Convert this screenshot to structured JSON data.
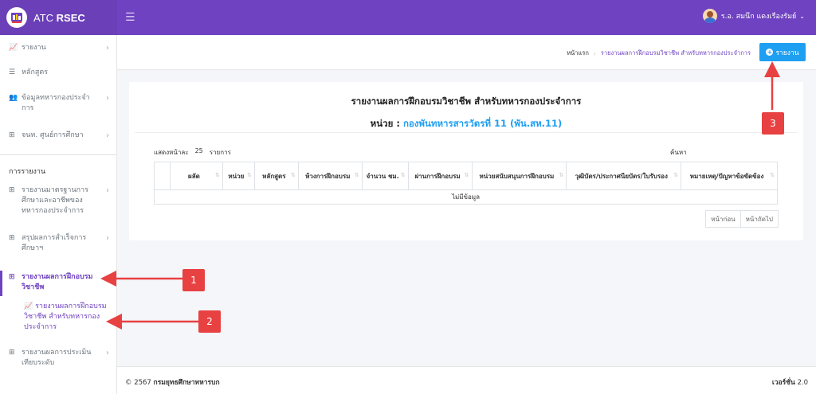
{
  "brand": {
    "name_prefix": "ATC",
    "name_bold": "RSEC"
  },
  "user": {
    "name": "ร.อ. สมนึก แดงเรืองรัมย์"
  },
  "sidebar": {
    "items": [
      {
        "label": "รายงาน",
        "icon": "bar-chart-icon"
      },
      {
        "label": "หลักสูตร",
        "icon": "list-icon"
      },
      {
        "label": "ข้อมูลทหารกองประจำการ",
        "icon": "users-icon"
      },
      {
        "label": "จนท. ศูนย์การศึกษา",
        "icon": "grid-icon"
      }
    ],
    "section_header": "การรายงาน",
    "report_items": [
      {
        "label": "รายงานมาตรฐานการศึกษาและอาชีพของทหารกองประจำการ"
      },
      {
        "label": "สรุปผลการสำเร็จการศึกษาฯ"
      },
      {
        "label": "รายงานผลการฝึกอบรมวิชาชีพ"
      },
      {
        "label": "รายงานผลการประเมินเทียบระดับ"
      }
    ],
    "sub_item": "รายงานผลการฝึกอบรมวิชาชีพ สำหรับทหารกองประจำการ"
  },
  "breadcrumb": {
    "home": "หน้าแรก",
    "current": "รายงานผลการฝึกอบรมวิชาชีพ สำหรับทหารกองประจำการ"
  },
  "toolbar": {
    "report_button": "รายงาน"
  },
  "card": {
    "title": "รายงานผลการฝึกอบรมวิชาชีพ สำหรับทหารกองประจำการ",
    "unit_label": "หน่วย :",
    "unit_name": "กองพันทหารสารวัตรที่ 11 (พัน.สห.11)"
  },
  "table_controls": {
    "show_label": "แสดงหน้าละ",
    "page_size": "25",
    "items_label": "รายการ",
    "search_label": "ค้นหา"
  },
  "table": {
    "columns": [
      "",
      "ผลัด",
      "หน่วย",
      "หลักสูตร",
      "ห้วงการฝึกอบรม",
      "จำนวน ชม.",
      "ผ่านการฝึกอบรม",
      "หน่วยสนับสนุนการฝึกอบรม",
      "วุฒิบัตร/ประกาศนียบัตร/ใบรับรอง",
      "หมายเหตุ/ปัญหาข้อขัดข้อง"
    ],
    "empty_message": "ไม่มีข้อมูล"
  },
  "pager": {
    "prev": "หน้าก่อน",
    "next": "หน้าถัดไป"
  },
  "footer": {
    "copyright": "© 2567",
    "org": "กรมยุทธศึกษาทหารบก",
    "version_label": "เวอร์ชั่น",
    "version": "2.0"
  },
  "callouts": [
    "1",
    "2",
    "3"
  ],
  "colors": {
    "primary": "#6f42c1",
    "accent": "#1e9ff2",
    "annotation": "#e84142"
  }
}
